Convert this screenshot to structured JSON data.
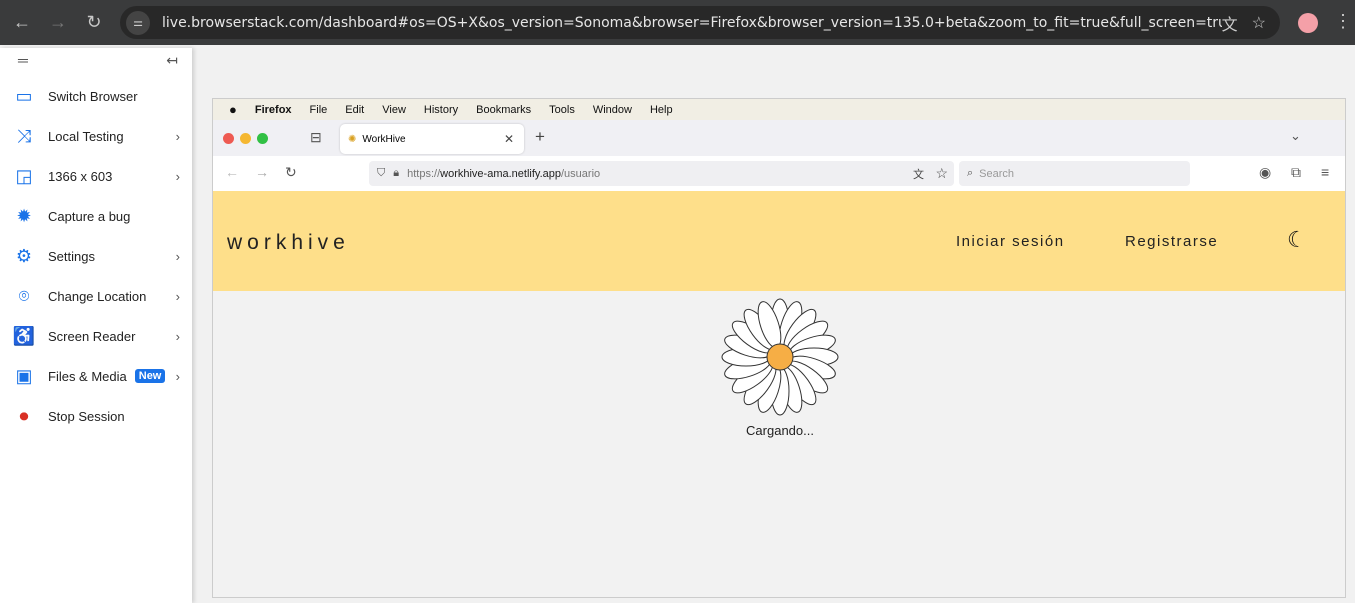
{
  "chrome": {
    "url": "live.browserstack.com/dashboard#os=OS+X&os_version=Sonoma&browser=Firefox&browser_version=135.0+beta&zoom_to_fit=true&full_screen=true&url=https%..."
  },
  "sidebar": {
    "items": [
      {
        "label": "Switch Browser",
        "icon": "switch-browser-icon",
        "glyph": "▭"
      },
      {
        "label": "Local Testing",
        "icon": "shuffle-icon",
        "glyph": "⤨",
        "chev": "›"
      },
      {
        "label": "1366 x 603",
        "icon": "resolution-icon",
        "glyph": "◲",
        "chev": "›"
      },
      {
        "label": "Capture a bug",
        "icon": "bug-icon",
        "glyph": "✹"
      },
      {
        "label": "Settings",
        "icon": "gear-icon",
        "glyph": "⚙",
        "chev": "›"
      },
      {
        "label": "Change Location",
        "icon": "location-pin-icon",
        "glyph": "⌾",
        "chev": "›"
      },
      {
        "label": "Screen Reader",
        "icon": "accessibility-icon",
        "glyph": "♿",
        "chev": "›"
      },
      {
        "label": "Files & Media",
        "icon": "media-icon",
        "glyph": "▣",
        "chev": "›",
        "badge": "New"
      },
      {
        "label": "Stop Session",
        "icon": "stop-icon",
        "glyph": "⏺",
        "color": "#d93025"
      }
    ]
  },
  "firefox": {
    "menu": [
      "Firefox",
      "File",
      "Edit",
      "View",
      "History",
      "Bookmarks",
      "Tools",
      "Window",
      "Help"
    ],
    "tab_title": "WorkHive",
    "url_prefix": "https://",
    "url_host": "workhive-ama.netlify.app",
    "url_path": "/usuario",
    "search_placeholder": "Search"
  },
  "page": {
    "logo": "workhive",
    "login": "Iniciar sesión",
    "register": "Registrarse",
    "loading": "Cargando..."
  },
  "colors": {
    "header": "#fedf8a",
    "accent": "#1a73e8",
    "flower_center": "#f6ae45"
  }
}
